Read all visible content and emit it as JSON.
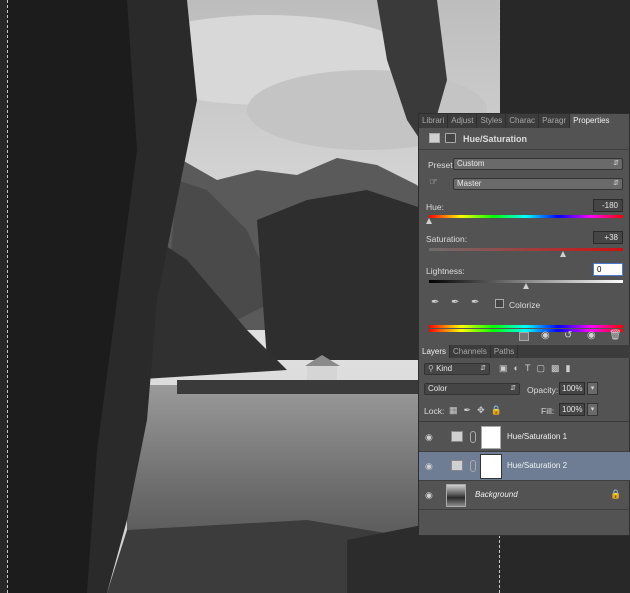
{
  "panel": {
    "tabs": [
      "Librari",
      "Adjust",
      "Styles",
      "Charac",
      "Paragr",
      "Properties"
    ],
    "active_tab": "Properties",
    "properties": {
      "title": "Hue/Saturation",
      "preset_label": "Preset:",
      "preset_value": "Custom",
      "channel_value": "Master",
      "hue_label": "Hue:",
      "hue_value": "-180",
      "hue_fraction": 0.0,
      "saturation_label": "Saturation:",
      "saturation_value": "+38",
      "saturation_fraction": 0.69,
      "lightness_label": "Lightness:",
      "lightness_value": "0",
      "lightness_fraction": 0.5,
      "colorize_label": "Colorize",
      "colorize_checked": false
    },
    "layers_tabs": [
      "Layers",
      "Channels",
      "Paths"
    ],
    "layers_active_tab": "Layers",
    "filter_kind": "Kind",
    "blend_mode": "Color",
    "opacity_label": "Opacity:",
    "opacity_value": "100%",
    "lock_label": "Lock:",
    "fill_label": "Fill:",
    "fill_value": "100%",
    "layers": [
      {
        "name": "Hue/Saturation 1",
        "type": "adjustment",
        "visible": true,
        "selected": false
      },
      {
        "name": "Hue/Saturation 2",
        "type": "adjustment",
        "visible": true,
        "selected": true
      },
      {
        "name": "Background",
        "type": "image",
        "visible": true,
        "selected": false,
        "locked": true
      }
    ]
  },
  "colors": {
    "panel_bg": "#535353",
    "selected_layer": "#6f7d94",
    "canvas_bg": "#282828"
  },
  "icons": [
    "eye-icon",
    "lock-icon",
    "chain-icon",
    "hand-tool-icon",
    "eyedropper-icon",
    "trash-icon",
    "reset-icon"
  ]
}
